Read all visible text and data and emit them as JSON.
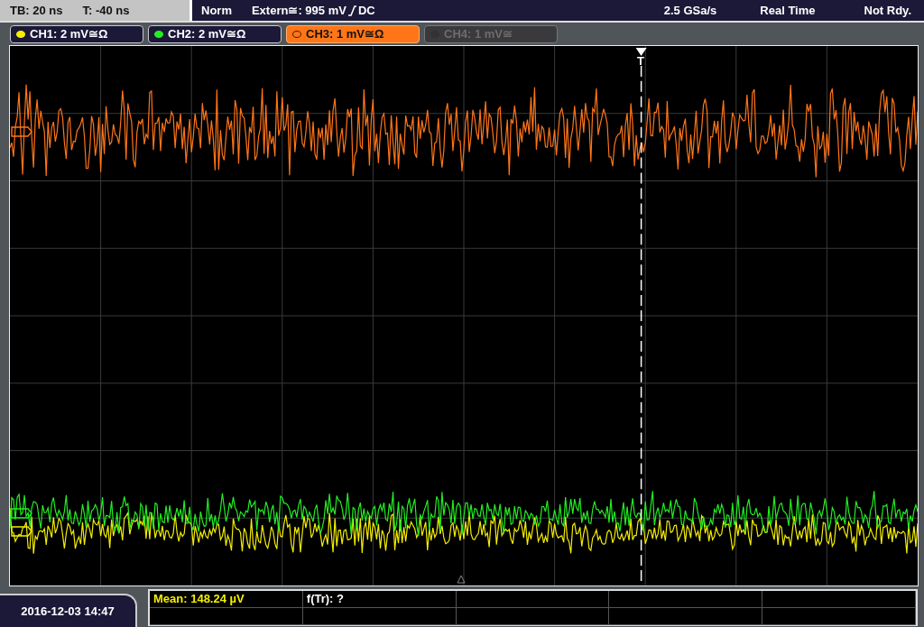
{
  "top_bar": {
    "timebase": "TB: 20 ns",
    "trigger_time": "T: -40 ns",
    "trigger_mode": "Norm",
    "trigger_level": "Extern≅: 995 mV",
    "trigger_coupling": "DC",
    "sample_rate": "2.5 GSa/s",
    "acquisition": "Real Time",
    "status": "Not Rdy."
  },
  "channels": [
    {
      "label": "CH1: 2 mV≅Ω",
      "color": "#f4ee00",
      "selected": false,
      "enabled": true
    },
    {
      "label": "CH2: 2 mV≅Ω",
      "color": "#22ee22",
      "selected": false,
      "enabled": true
    },
    {
      "label": "CH3: 1 mV≅Ω",
      "color": "#ff7518",
      "selected": true,
      "enabled": true
    },
    {
      "label": "CH4: 1 mV≅",
      "color": "#333333",
      "selected": false,
      "enabled": false
    }
  ],
  "trigger_marker": "T",
  "date_time": "2016-12-03 14:47",
  "measurements": [
    {
      "text": "Mean: 148.24 µV",
      "color": "#f4ee00"
    },
    {
      "text": "f(Tr): ?",
      "color": "#ffffff"
    }
  ]
}
